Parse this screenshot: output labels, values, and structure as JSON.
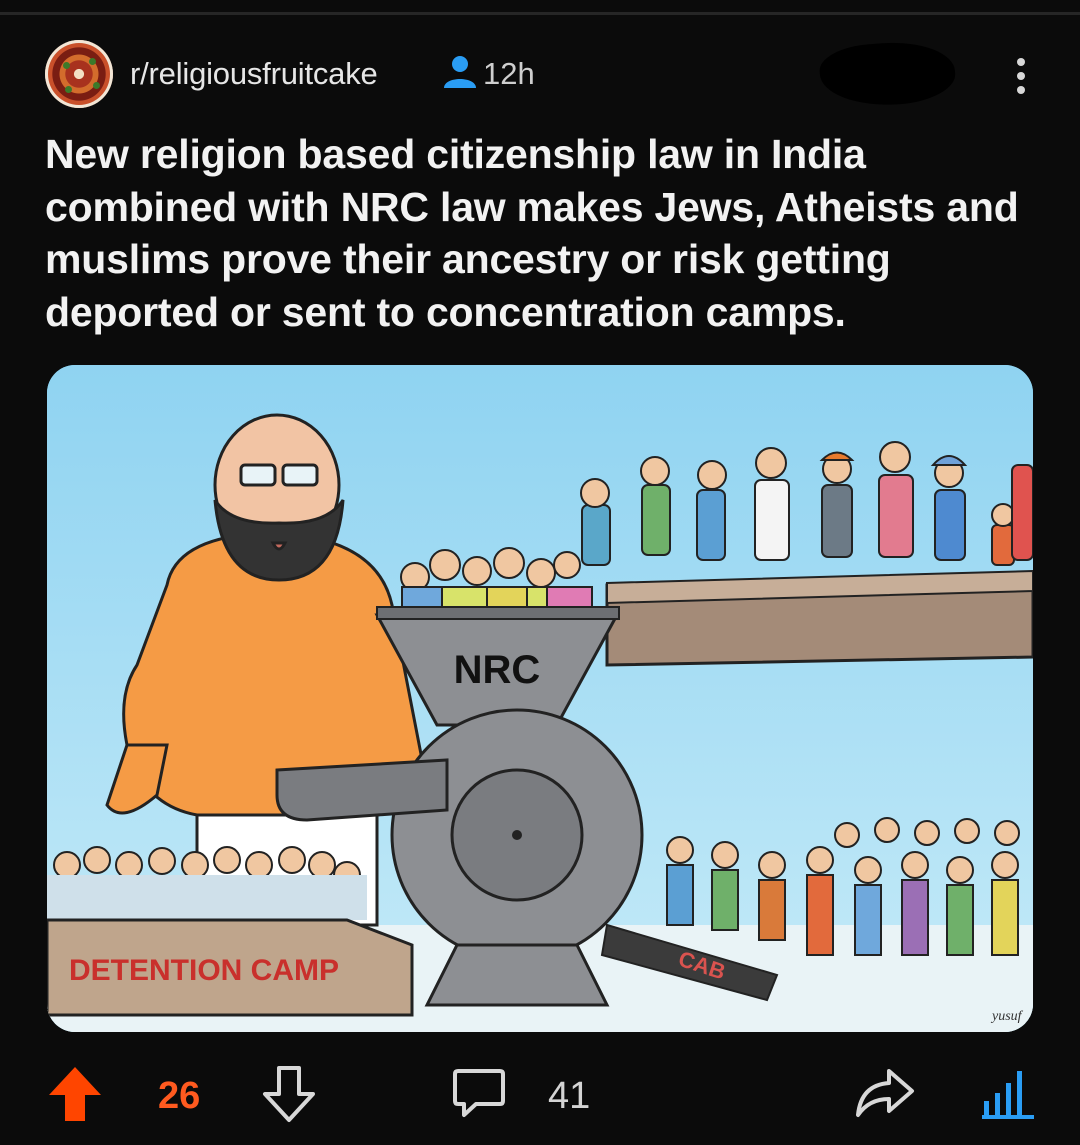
{
  "post": {
    "subreddit": "r/religiousfruitcake",
    "age": "12h",
    "title": "New religion based citizenship law in India combined with NRC law makes Jews, Atheists and muslims prove their ancestry or risk getting deported or sent to concentration camps.",
    "image": {
      "machine_label": "NRC",
      "ramp_label": "CAB",
      "sign_label": "DETENTION CAMP",
      "artist_signature": "yusuf"
    }
  },
  "actions": {
    "score": "26",
    "comments": "41"
  },
  "colors": {
    "background": "#0b0b0b",
    "upvote_accent": "#ff4500",
    "user_icon": "#2a9df4",
    "stats_icon": "#2a9df4"
  },
  "icons": [
    "subreddit-avatar",
    "user-icon",
    "more-icon",
    "upvote-icon",
    "downvote-icon",
    "comment-icon",
    "share-icon",
    "stats-icon"
  ]
}
